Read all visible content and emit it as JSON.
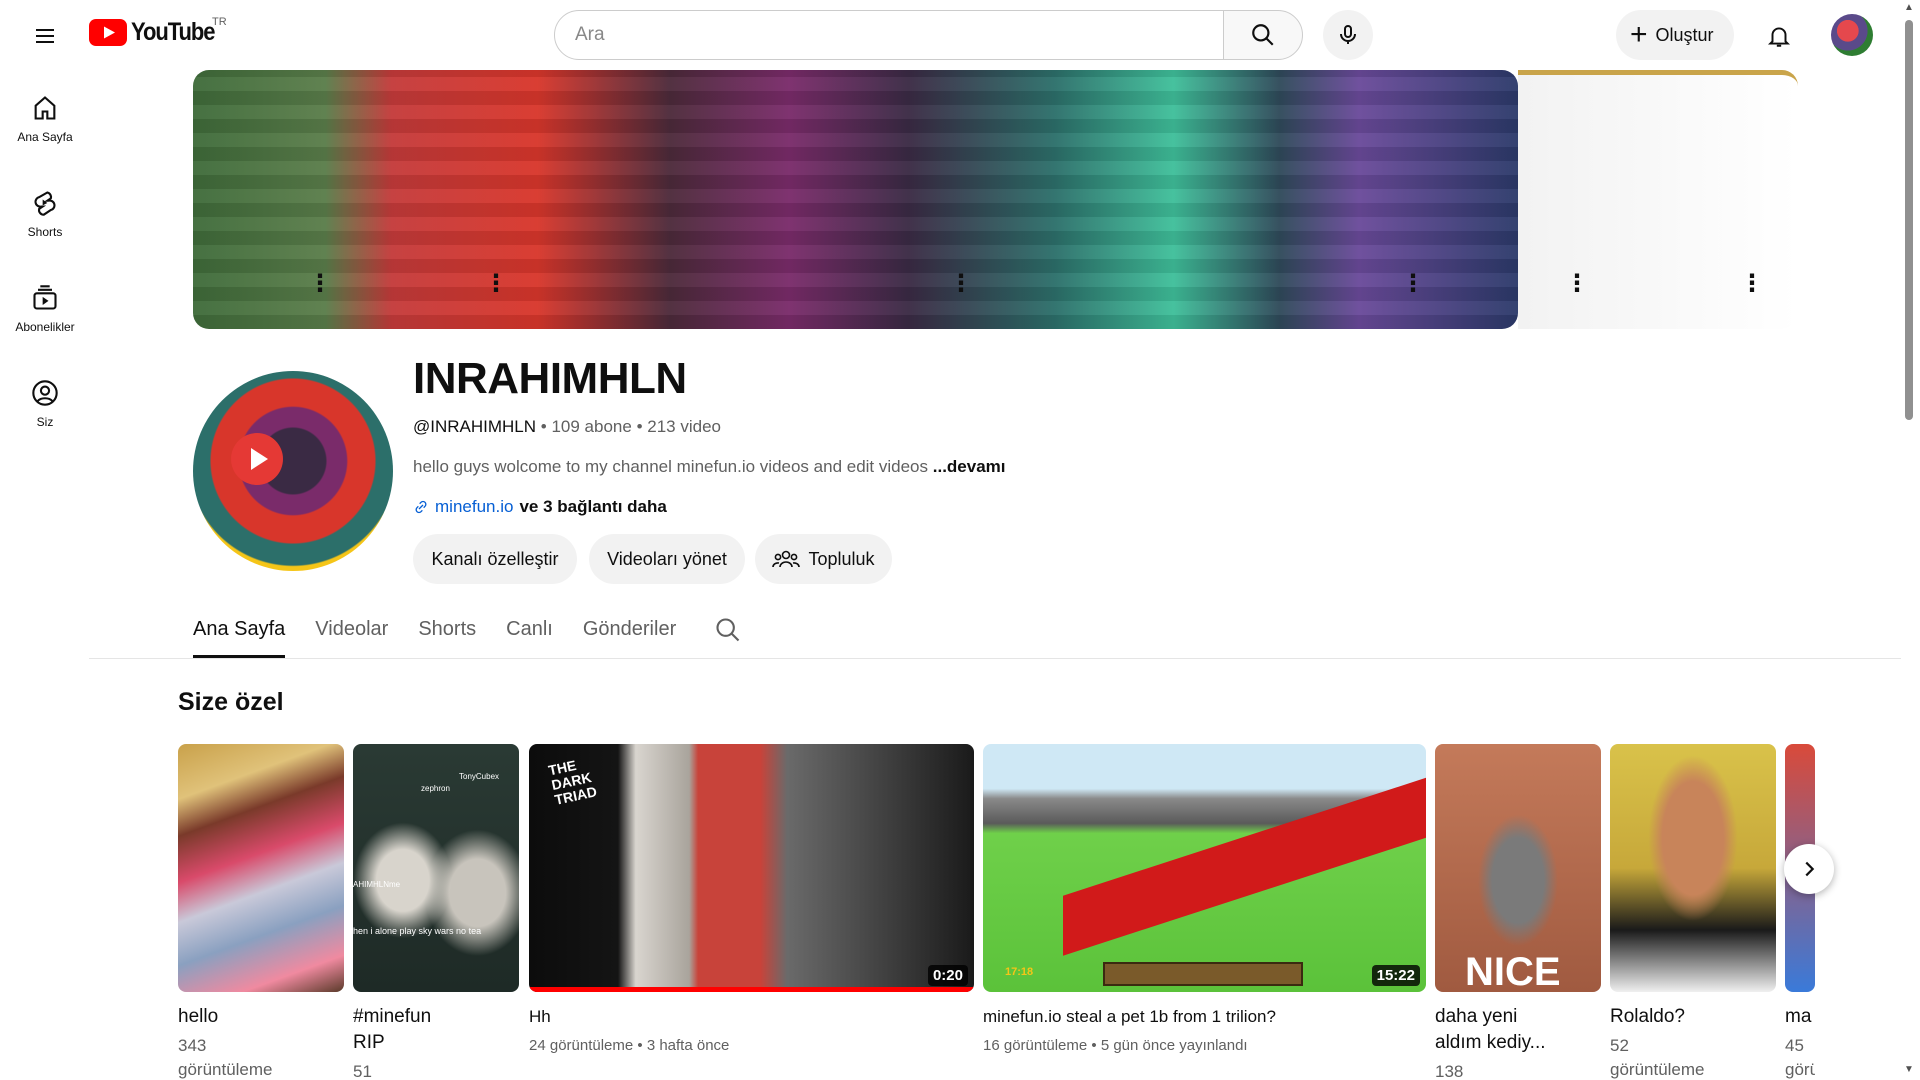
{
  "header": {
    "logo_text": "YouTube",
    "country": "TR",
    "search_placeholder": "Ara",
    "create_label": "Oluştur"
  },
  "sidebar": {
    "items": [
      {
        "label": "Ana Sayfa",
        "icon": "home-icon"
      },
      {
        "label": "Shorts",
        "icon": "shorts-icon"
      },
      {
        "label": "Abonelikler",
        "icon": "subscriptions-icon"
      },
      {
        "label": "Siz",
        "icon": "you-icon"
      }
    ]
  },
  "channel": {
    "name": "INRAHIMHLN",
    "handle": "@INRAHIMHLN",
    "subscribers": "109 abone",
    "videos": "213 video",
    "description": "hello guys wolcome to my channel minefun.io videos and edit videos",
    "more_label": "...devamı",
    "link_text": "minefun.io",
    "extra_links": "ve 3 bağlantı daha",
    "buttons": {
      "customize": "Kanalı özelleştir",
      "manage": "Videoları yönet",
      "community": "Topluluk"
    }
  },
  "tabs": [
    "Ana Sayfa",
    "Videolar",
    "Shorts",
    "Canlı",
    "Gönderiler"
  ],
  "section": {
    "title": "Size özel",
    "items": [
      {
        "title": "hello",
        "line1": "343",
        "line2": "görüntüleme"
      },
      {
        "title": "#minefun RIP",
        "title_l1": "#minefun",
        "title_l2": "RIP",
        "line1": "51"
      },
      {
        "title": "Hh",
        "meta": "24 görüntüleme • 3 hafta önce",
        "duration": "0:20",
        "progress": 1.0
      },
      {
        "title": "minefun.io steal a pet 1b from 1 trilion?",
        "meta": "16 görüntüleme • 5 gün önce yayınlandı",
        "duration": "15:22",
        "hud_text": "17:18"
      },
      {
        "title_l1": "daha yeni",
        "title_l2": "aldım kediy...",
        "line1": "138"
      },
      {
        "title": "Rolaldo?",
        "line1": "52",
        "line2": "görüntüleme"
      },
      {
        "title": "ma",
        "line1": "45",
        "line2": "görü"
      }
    ],
    "thumb_texts": {
      "dark_triad": "THE DARK TRIAD",
      "minefun_caption": "hen i alone play sky wars no tea",
      "name_tag_1": "TonyCubex",
      "name_tag_2": "zephron",
      "name_tag_3": "AHIMHLNme",
      "nice_text": "NICE"
    }
  }
}
